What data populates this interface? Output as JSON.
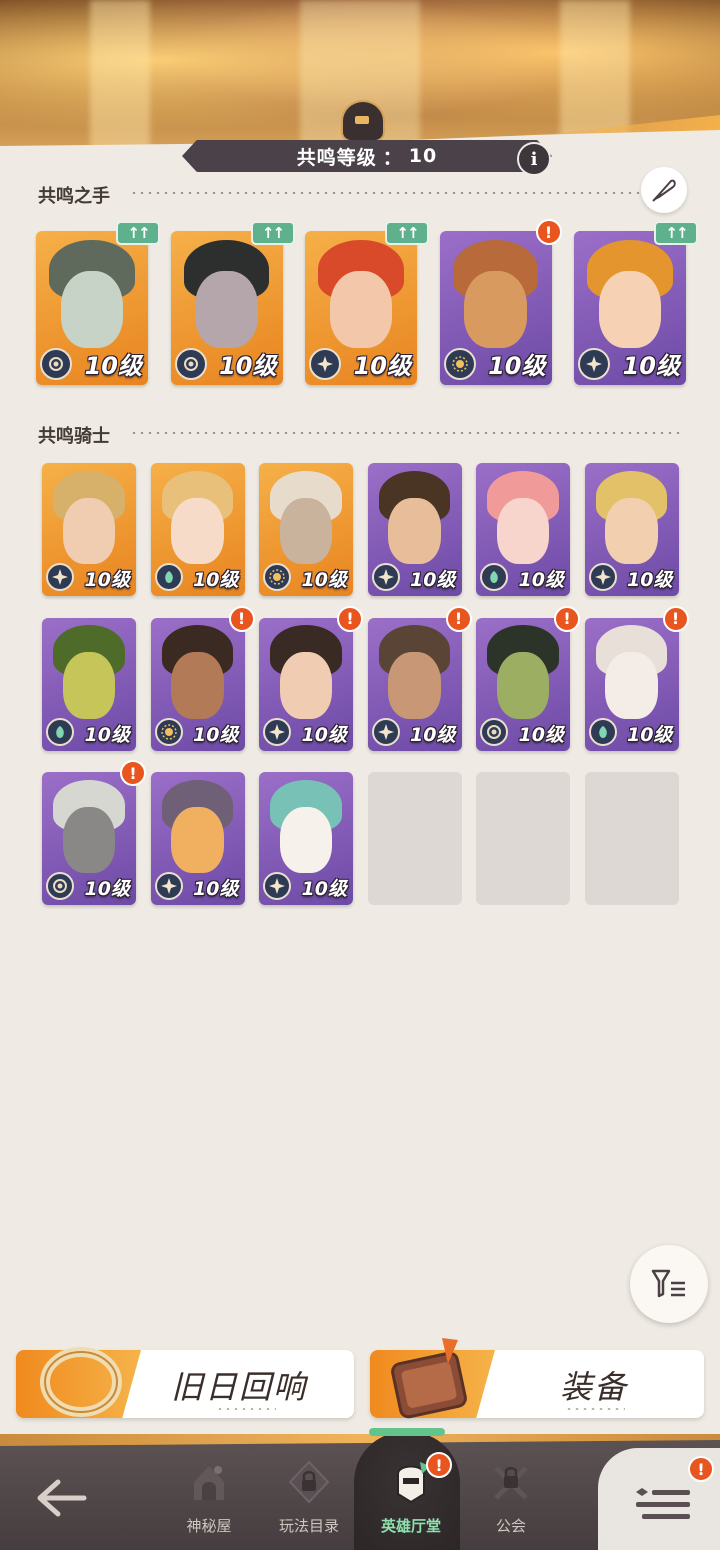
{
  "header": {
    "level_label": "共鸣等级",
    "level_sep": "：",
    "level_value": "10",
    "info_glyph": "i"
  },
  "hands_section": {
    "title": "共鸣之手",
    "cards": [
      {
        "level": "10级",
        "frame": "orange",
        "badge": "eye-icon",
        "tag": "upgrade",
        "tag_text": "↑↑",
        "hair": "#5f6a5d",
        "skin": "#c7d3c6"
      },
      {
        "level": "10级",
        "frame": "orange",
        "badge": "eye-icon",
        "tag": "upgrade",
        "tag_text": "↑↑",
        "hair": "#2d2e2e",
        "skin": "#b4a6aa"
      },
      {
        "level": "10级",
        "frame": "orange",
        "badge": "star-icon",
        "tag": "upgrade",
        "tag_text": "↑↑",
        "hair": "#d84a2a",
        "skin": "#f2c7aa"
      },
      {
        "level": "10级",
        "frame": "purple",
        "badge": "sun-icon",
        "tag": "alert",
        "tag_text": "!",
        "hair": "#b86a3a",
        "skin": "#d99a60"
      },
      {
        "level": "10级",
        "frame": "purple",
        "badge": "star-icon",
        "tag": "upgrade",
        "tag_text": "↑↑",
        "hair": "#e4952e",
        "skin": "#f7d1b4"
      }
    ]
  },
  "knights_section": {
    "title": "共鸣骑士",
    "cards": [
      {
        "level": "10级",
        "frame": "orange",
        "badge": "star-icon",
        "tag": "",
        "hair": "#d7b06a",
        "skin": "#f0cdb0"
      },
      {
        "level": "10级",
        "frame": "orange",
        "badge": "leaf-icon",
        "tag": "",
        "hair": "#e8c07a",
        "skin": "#f6dcc8"
      },
      {
        "level": "10级",
        "frame": "orange",
        "badge": "sun-icon",
        "tag": "",
        "hair": "#e7dccb",
        "skin": "#c9b39c"
      },
      {
        "level": "10级",
        "frame": "purple",
        "badge": "star-icon",
        "tag": "",
        "hair": "#4a3424",
        "skin": "#e7bd9a"
      },
      {
        "level": "10级",
        "frame": "purple",
        "badge": "leaf-icon",
        "tag": "",
        "hair": "#f19a9a",
        "skin": "#f7d5cc"
      },
      {
        "level": "10级",
        "frame": "purple",
        "badge": "star-icon",
        "tag": "",
        "hair": "#e2c168",
        "skin": "#f2cfae"
      },
      {
        "level": "10级",
        "frame": "purple",
        "badge": "leaf-icon",
        "tag": "",
        "hair": "#4f6b2a",
        "skin": "#c6c55a"
      },
      {
        "level": "10级",
        "frame": "purple",
        "badge": "sun-icon",
        "tag": "alert",
        "tag_text": "!",
        "hair": "#3b2a22",
        "skin": "#b27a56"
      },
      {
        "level": "10级",
        "frame": "purple",
        "badge": "star-icon",
        "tag": "alert",
        "tag_text": "!",
        "hair": "#3a2a24",
        "skin": "#f0cdb2"
      },
      {
        "level": "10级",
        "frame": "purple",
        "badge": "star-icon",
        "tag": "alert",
        "tag_text": "!",
        "hair": "#5a4436",
        "skin": "#c89876"
      },
      {
        "level": "10级",
        "frame": "purple",
        "badge": "eye-icon",
        "tag": "alert",
        "tag_text": "!",
        "hair": "#2c3328",
        "skin": "#9cae62"
      },
      {
        "level": "10级",
        "frame": "purple",
        "badge": "leaf-icon",
        "tag": "alert",
        "tag_text": "!",
        "hair": "#e8e0d8",
        "skin": "#f4ece6"
      },
      {
        "level": "10级",
        "frame": "purple",
        "badge": "eye-icon",
        "tag": "alert",
        "tag_text": "!",
        "hair": "#d7d7d2",
        "skin": "#8a8886"
      },
      {
        "level": "10级",
        "frame": "purple",
        "badge": "star-icon",
        "tag": "",
        "hair": "#6f6078",
        "skin": "#f0b060"
      },
      {
        "level": "10级",
        "frame": "purple",
        "badge": "star-icon",
        "tag": "",
        "hair": "#78c1b6",
        "skin": "#f7f1ec"
      },
      {
        "empty": true
      },
      {
        "empty": true
      },
      {
        "empty": true
      }
    ]
  },
  "actions": {
    "echoes_label": "旧日回响",
    "equipment_label": "装备"
  },
  "nav": {
    "items": [
      {
        "label": "神秘屋",
        "icon": "mystery-house-icon",
        "active": false
      },
      {
        "label": "玩法目录",
        "icon": "locked-catalog-icon",
        "active": false
      },
      {
        "label": "英雄厅堂",
        "icon": "hero-hall-icon",
        "active": true,
        "alert": "!"
      },
      {
        "label": "公会",
        "icon": "guild-icon",
        "active": false
      }
    ],
    "menu_alert": "!"
  },
  "colors": {
    "accent_orange": "#f08a1e",
    "upgrade_green": "#5fb08c",
    "alert_red": "#e8551f",
    "nav_active_green": "#8fe1b0"
  }
}
